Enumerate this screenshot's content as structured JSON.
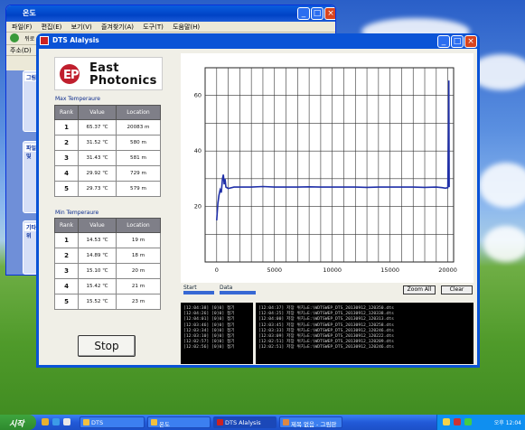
{
  "background_window": {
    "title": "온도",
    "menu": [
      "파일(F)",
      "편집(E)",
      "보기(V)",
      "즐겨찾기(A)",
      "도구(T)",
      "도움말(H)"
    ],
    "addr_label": "주소(D)",
    "back_label": "뒤로",
    "panel1_title": "그림",
    "panel2_title": "파일 및",
    "panel3_title": "기타 위"
  },
  "app": {
    "title": "DTS Alalysis",
    "logo_line1": "East",
    "logo_line2": "Photonics",
    "max_section": "Max Temperaure",
    "min_section": "Min Temperaure",
    "columns": [
      "Rank",
      "Value",
      "Location"
    ],
    "max_rows": [
      {
        "rank": "1",
        "value": "65.37 ℃",
        "location": "20083 m"
      },
      {
        "rank": "2",
        "value": "31.52 ℃",
        "location": "580 m"
      },
      {
        "rank": "3",
        "value": "31.43 ℃",
        "location": "581 m"
      },
      {
        "rank": "4",
        "value": "29.92 ℃",
        "location": "729 m"
      },
      {
        "rank": "5",
        "value": "29.73 ℃",
        "location": "579 m"
      }
    ],
    "min_rows": [
      {
        "rank": "1",
        "value": "14.53 ℃",
        "location": "19 m"
      },
      {
        "rank": "2",
        "value": "14.89 ℃",
        "location": "18 m"
      },
      {
        "rank": "3",
        "value": "15.10 ℃",
        "location": "20 m"
      },
      {
        "rank": "4",
        "value": "15.42 ℃",
        "location": "21 m"
      },
      {
        "rank": "5",
        "value": "15.52 ℃",
        "location": "23 m"
      }
    ],
    "stop_label": "Stop",
    "start_label": "Start",
    "data_label": "Data",
    "zoom_all_label": "Zoom All",
    "clear_label": "Clear",
    "log_left": [
      "[12:04:38] [0]0] 접기",
      "[12:04:26] [0]0] 접기",
      "[12:04:01] [0]0] 접기",
      "[12:03:46] [0]0] 접기",
      "[12:03:34] [0]0] 접기",
      "[12:03:10] [0]0] 접기",
      "[12:02:57] [0]0] 접기",
      "[12:02:56] [0]0] 접기"
    ],
    "log_right": [
      "[12:04:37] 저장 위치=E:\\WDTSWEP_DTS_20130912_120350.dts",
      "[12:04:25] 저장 위치=E:\\WDTSWEP_DTS_20130912_120338.dts",
      "[12:04:00] 저장 위치=E:\\WDTSWEP_DTS_20130912_120313.dts",
      "[12:03:45] 저장 위치=E:\\WDTSWEP_DTS_20130912_120258.dts",
      "[12:03:33] 저장 위치=E:\\WDTSWEP_DTS_20130912_120246.dts",
      "[12:03:09] 저장 위치=E:\\WDTSWEP_DTS_20130912_120222.dts",
      "[12:02:51] 저장 위치=E:\\WDTSWEP_DTS_20130912_120209.dts",
      "[12:02:51] 저장 위치=E:\\WDTSWEP_DTS_20130912_120246.dts"
    ]
  },
  "chart_data": {
    "type": "line",
    "xlim": [
      -1000,
      20500
    ],
    "ylim": [
      0,
      70
    ],
    "x_ticks": [
      0,
      5000,
      10000,
      15000,
      20000
    ],
    "x_tick_labels": [
      "0",
      "5000",
      "10000",
      "15000",
      "20000"
    ],
    "y_ticks": [
      20,
      40,
      60
    ],
    "y_tick_labels": [
      "20",
      "40",
      "60"
    ],
    "grid": true,
    "series": [
      {
        "color": "#1f2fa8",
        "x": [
          0,
          100,
          200,
          300,
          400,
          500,
          580,
          650,
          730,
          800,
          1000,
          1500,
          2000,
          3000,
          4000,
          5000,
          6000,
          7000,
          8000,
          9000,
          10000,
          11000,
          12000,
          13000,
          14000,
          15000,
          16000,
          17000,
          18000,
          19000,
          19500,
          19800,
          20000,
          20050,
          20083,
          20120
        ],
        "y": [
          15,
          21,
          24,
          26,
          25,
          30,
          31.5,
          28,
          29.9,
          27,
          26.5,
          27,
          27,
          27,
          27.2,
          27,
          27,
          27,
          27.1,
          27,
          27,
          27,
          27,
          26.9,
          27,
          27,
          27,
          27,
          26.9,
          27,
          26.8,
          26.6,
          26.8,
          45,
          65.4,
          27
        ]
      }
    ]
  },
  "taskbar": {
    "start_label": "시작",
    "tasks": [
      "DTS",
      "온도",
      "DTS Alalysis",
      "제목 없음 - 그림판"
    ],
    "clock": "오후 12:04"
  }
}
